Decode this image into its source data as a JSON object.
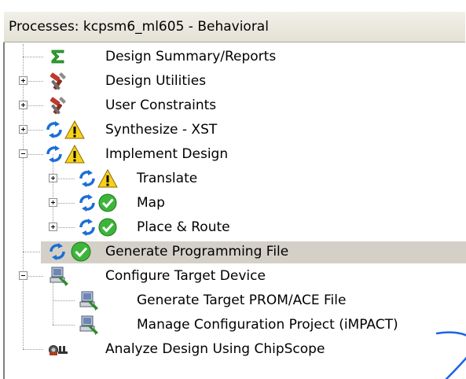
{
  "panel": {
    "title": "Processes: kcpsm6_ml605 - Behavioral"
  },
  "processes": [
    {
      "label": "Design Summary/Reports",
      "icon": "sigma-icon",
      "expander": "none",
      "selected": false
    },
    {
      "label": "Design Utilities",
      "icon": "tools-icon",
      "expander": "plus",
      "selected": false
    },
    {
      "label": "User Constraints",
      "icon": "tools-icon",
      "expander": "plus",
      "selected": false
    },
    {
      "label": "Synthesize - XST",
      "icon": "refresh-warning-icon",
      "expander": "plus",
      "selected": false
    },
    {
      "label": "Implement Design",
      "icon": "refresh-warning-icon",
      "expander": "minus",
      "selected": false
    },
    {
      "label": "Translate",
      "icon": "refresh-warning-icon",
      "expander": "plus",
      "selected": false
    },
    {
      "label": "Map",
      "icon": "refresh-check-icon",
      "expander": "plus",
      "selected": false
    },
    {
      "label": "Place & Route",
      "icon": "refresh-check-icon",
      "expander": "plus",
      "selected": false
    },
    {
      "label": "Generate Programming File",
      "icon": "refresh-check-icon",
      "expander": "none",
      "selected": true
    },
    {
      "label": "Configure Target Device",
      "icon": "device-config-icon",
      "expander": "minus",
      "selected": false
    },
    {
      "label": "Generate Target PROM/ACE File",
      "icon": "device-config-icon",
      "expander": "none",
      "selected": false
    },
    {
      "label": "Manage Configuration Project (iMPACT)",
      "icon": "device-config-icon",
      "expander": "none",
      "selected": false
    },
    {
      "label": "Analyze Design Using ChipScope",
      "icon": "chipscope-icon",
      "expander": "none",
      "selected": false
    }
  ],
  "colors": {
    "selection": "#d4d0c8",
    "refresh_blue": "#1a6fd6",
    "warning_yellow": "#f7d21a",
    "check_green": "#3db53a",
    "annotation_stroke": "#1e63e6"
  }
}
